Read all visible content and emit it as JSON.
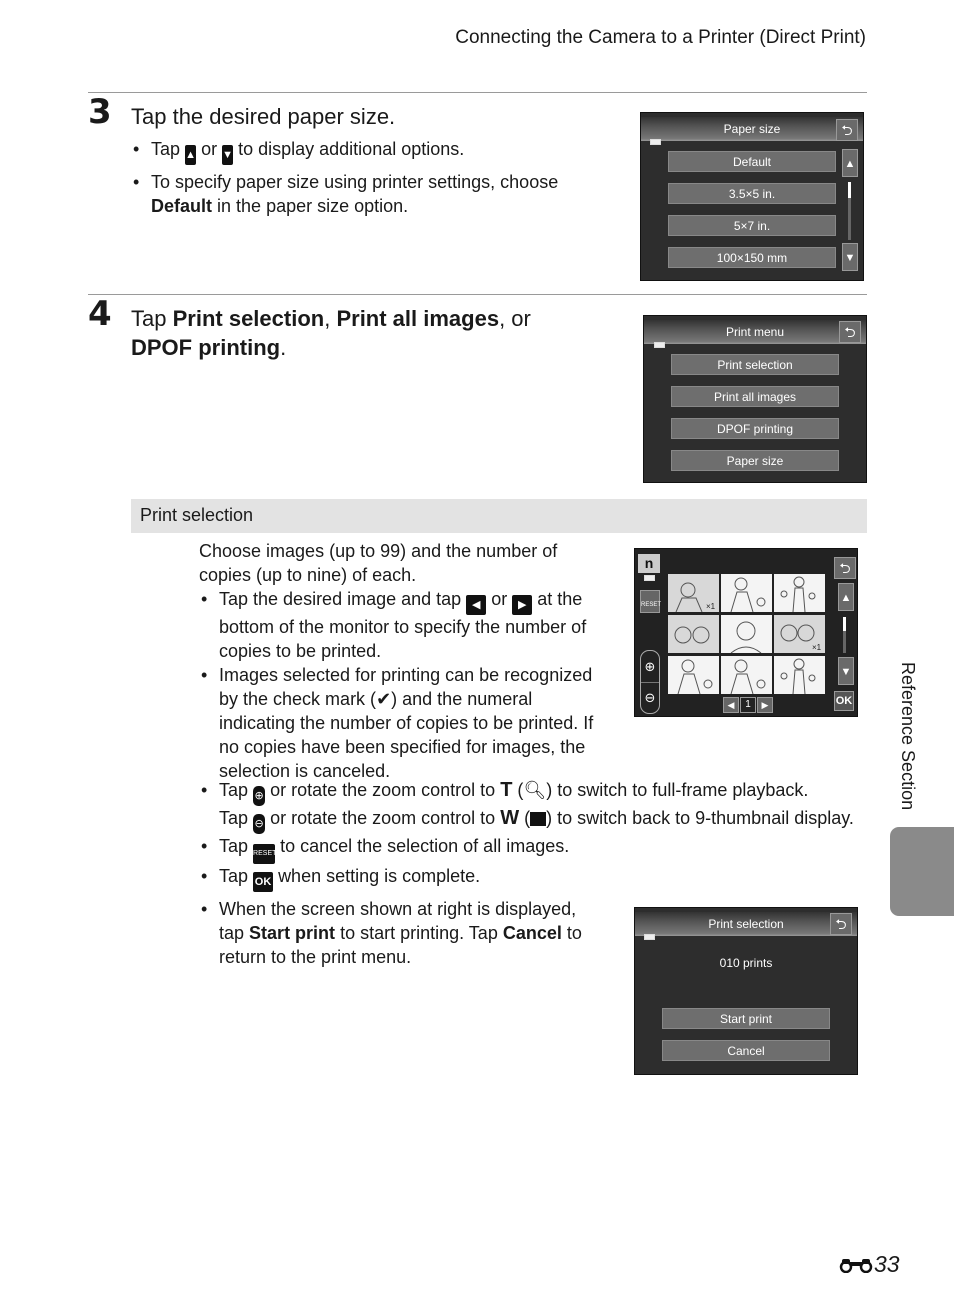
{
  "header": {
    "title": "Connecting the Camera to a Printer (Direct Print)"
  },
  "step3": {
    "number": "3",
    "title": "Tap the desired paper size.",
    "bullets": {
      "b1_pre": "Tap",
      "b1_or": "or",
      "b1_post": "to display additional options.",
      "b2_pre": "To specify paper size using printer settings, choose",
      "b2_bold": "Default",
      "b2_post": "in the paper size option."
    },
    "screen": {
      "title": "Paper size",
      "options": [
        "Default",
        "3.5×5 in.",
        "5×7 in.",
        "100×150 mm"
      ],
      "scroll_position": 0.0
    }
  },
  "step4": {
    "number": "4",
    "title": {
      "pre": "Tap",
      "b1": "Print selection",
      "sep1": ",",
      "b2": "Print all images",
      "sep2": ", or",
      "b3": "DPOF printing",
      "end": "."
    },
    "screen": {
      "title": "Print menu",
      "options": [
        "Print selection",
        "Print all images",
        "DPOF printing",
        "Paper size"
      ]
    }
  },
  "print_selection": {
    "heading": "Print selection",
    "intro": "Choose images (up to 99) and the number of copies (up to nine) of each.",
    "b1_pre": "Tap the desired image and tap",
    "b1_or": "or",
    "b1_post": "at the bottom of the monitor to specify the number of copies to be printed.",
    "b2_pre": "Images selected for printing can be recognized by the check mark (",
    "b2_post": ") and the numeral indicating the number of copies to be printed. If no copies have been specified for images, the selection is canceled.",
    "b3_l1_pre": "Tap",
    "b3_l1_mid": "or rotate the zoom control to",
    "b3_l1_T": "T",
    "b3_l1_post": ") to switch to full-frame playback.",
    "b3_l2_pre": "Tap",
    "b3_l2_mid": "or rotate the zoom control to",
    "b3_l2_W": "W",
    "b3_l2_post": ") to switch back to 9-thumbnail display.",
    "b4_pre": "Tap",
    "b4_post": "to cancel the selection of all images.",
    "b5_pre": "Tap",
    "b5_post": "when setting is complete.",
    "b6_pre": "When the screen shown at right is displayed, tap",
    "b6_b1": "Start print",
    "b6_mid": "to start printing. Tap",
    "b6_b2": "Cancel",
    "b6_post": "to return to the print menu.",
    "icons": {
      "reset": "RESET",
      "ok": "OK"
    },
    "thumb_screen": {
      "counter": "1",
      "ok_label": "OK",
      "reset_label": "RESET",
      "copies_marks": [
        "×1",
        "×1"
      ]
    },
    "confirm_screen": {
      "title": "Print selection",
      "prints": "010 prints",
      "start": "Start print",
      "cancel": "Cancel"
    }
  },
  "side": {
    "label": "Reference Section"
  },
  "footer": {
    "page": "33"
  }
}
